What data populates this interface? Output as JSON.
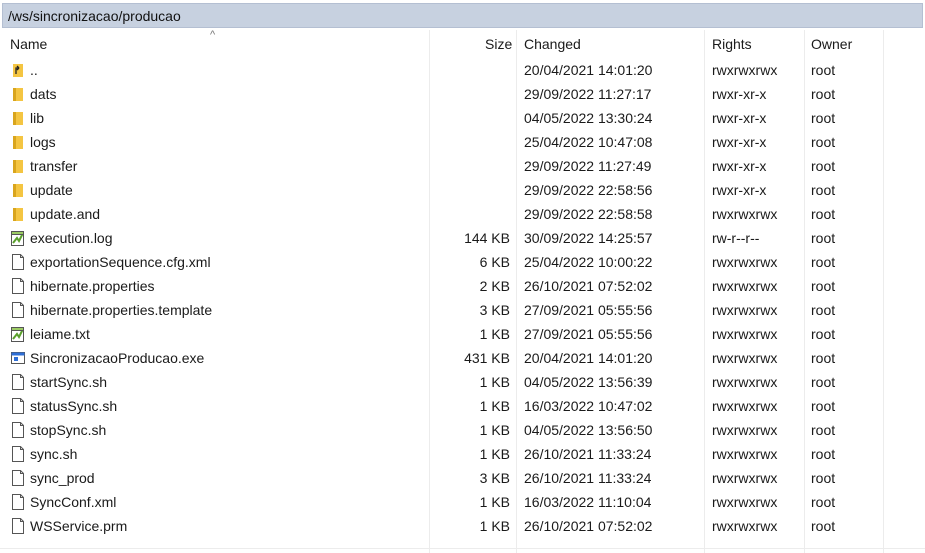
{
  "path": "/ws/sincronizacao/producao",
  "columns": {
    "name": "Name",
    "size": "Size",
    "changed": "Changed",
    "rights": "Rights",
    "owner": "Owner"
  },
  "sort_icon": "sort-ascending-icon",
  "files": [
    {
      "name": "..",
      "size": "",
      "changed": "20/04/2021 14:01:20",
      "rights": "rwxrwxrwx",
      "owner": "root",
      "icon": "parent-folder-icon"
    },
    {
      "name": "dats",
      "size": "",
      "changed": "29/09/2022 11:27:17",
      "rights": "rwxr-xr-x",
      "owner": "root",
      "icon": "folder-icon"
    },
    {
      "name": "lib",
      "size": "",
      "changed": "04/05/2022 13:30:24",
      "rights": "rwxr-xr-x",
      "owner": "root",
      "icon": "folder-icon"
    },
    {
      "name": "logs",
      "size": "",
      "changed": "25/04/2022 10:47:08",
      "rights": "rwxr-xr-x",
      "owner": "root",
      "icon": "folder-icon"
    },
    {
      "name": "transfer",
      "size": "",
      "changed": "29/09/2022 11:27:49",
      "rights": "rwxr-xr-x",
      "owner": "root",
      "icon": "folder-icon"
    },
    {
      "name": "update",
      "size": "",
      "changed": "29/09/2022 22:58:56",
      "rights": "rwxr-xr-x",
      "owner": "root",
      "icon": "folder-icon"
    },
    {
      "name": "update.and",
      "size": "",
      "changed": "29/09/2022 22:58:58",
      "rights": "rwxrwxrwx",
      "owner": "root",
      "icon": "folder-icon"
    },
    {
      "name": "execution.log",
      "size": "144 KB",
      "changed": "30/09/2022 14:25:57",
      "rights": "rw-r--r--",
      "owner": "root",
      "icon": "text-document-icon"
    },
    {
      "name": "exportationSequence.cfg.xml",
      "size": "6 KB",
      "changed": "25/04/2022 10:00:22",
      "rights": "rwxrwxrwx",
      "owner": "root",
      "icon": "file-icon"
    },
    {
      "name": "hibernate.properties",
      "size": "2 KB",
      "changed": "26/10/2021 07:52:02",
      "rights": "rwxrwxrwx",
      "owner": "root",
      "icon": "file-icon"
    },
    {
      "name": "hibernate.properties.template",
      "size": "3 KB",
      "changed": "27/09/2021 05:55:56",
      "rights": "rwxrwxrwx",
      "owner": "root",
      "icon": "file-icon"
    },
    {
      "name": "leiame.txt",
      "size": "1 KB",
      "changed": "27/09/2021 05:55:56",
      "rights": "rwxrwxrwx",
      "owner": "root",
      "icon": "text-document-icon"
    },
    {
      "name": "SincronizacaoProducao.exe",
      "size": "431 KB",
      "changed": "20/04/2021 14:01:20",
      "rights": "rwxrwxrwx",
      "owner": "root",
      "icon": "executable-icon"
    },
    {
      "name": "startSync.sh",
      "size": "1 KB",
      "changed": "04/05/2022 13:56:39",
      "rights": "rwxrwxrwx",
      "owner": "root",
      "icon": "file-icon"
    },
    {
      "name": "statusSync.sh",
      "size": "1 KB",
      "changed": "16/03/2022 10:47:02",
      "rights": "rwxrwxrwx",
      "owner": "root",
      "icon": "file-icon"
    },
    {
      "name": "stopSync.sh",
      "size": "1 KB",
      "changed": "04/05/2022 13:56:50",
      "rights": "rwxrwxrwx",
      "owner": "root",
      "icon": "file-icon"
    },
    {
      "name": "sync.sh",
      "size": "1 KB",
      "changed": "26/10/2021 11:33:24",
      "rights": "rwxrwxrwx",
      "owner": "root",
      "icon": "file-icon"
    },
    {
      "name": "sync_prod",
      "size": "3 KB",
      "changed": "26/10/2021 11:33:24",
      "rights": "rwxrwxrwx",
      "owner": "root",
      "icon": "file-icon"
    },
    {
      "name": "SyncConf.xml",
      "size": "1 KB",
      "changed": "16/03/2022 11:10:04",
      "rights": "rwxrwxrwx",
      "owner": "root",
      "icon": "file-icon"
    },
    {
      "name": "WSService.prm",
      "size": "1 KB",
      "changed": "26/10/2021 07:52:02",
      "rights": "rwxrwxrwx",
      "owner": "root",
      "icon": "file-icon"
    }
  ],
  "colors": {
    "pathbar_bg": "#c7d1e0",
    "folder": "#f4c542",
    "exe_accent": "#2f6fd6"
  }
}
